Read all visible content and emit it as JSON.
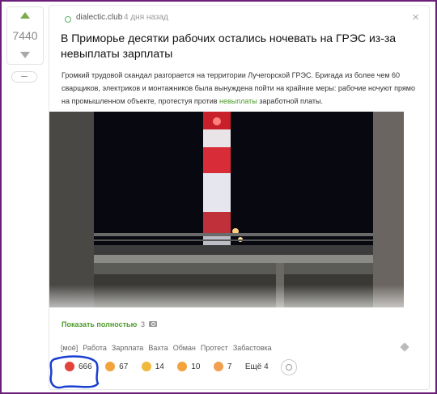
{
  "vote": {
    "count": "7440"
  },
  "post": {
    "source": "dialectic.club",
    "time": "4 дня назад",
    "close": "×",
    "title": "В Приморье десятки рабочих остались ночевать на ГРЭС из-за невыплаты зарплаты",
    "text_before": "Громкий трудовой скандал разгорается на территории Лучегорской ГРЭС. Бригада из более чем 60 сварщиков, электриков и монтажников была вынуждена пойти на крайние меры: рабочие ночуют прямо на промышленном объекте, протестуя против ",
    "text_link": "невыплаты",
    "text_after": " заработной платы.",
    "show_more": "Показать полностью",
    "photo_count": "3"
  },
  "tags": [
    "[моё]",
    "Работа",
    "Зарплата",
    "Вахта",
    "Обман",
    "Протест",
    "Забастовка"
  ],
  "reactions": [
    {
      "icon": "angry-face-icon",
      "count": "666",
      "color": "#e2433a"
    },
    {
      "icon": "crying-face-icon",
      "count": "67",
      "color": "#f1a33c"
    },
    {
      "icon": "laughing-face-icon",
      "count": "14",
      "color": "#f1b93c"
    },
    {
      "icon": "grinning-face-icon",
      "count": "10",
      "color": "#f1a33c"
    },
    {
      "icon": "clapping-hands-icon",
      "count": "7",
      "color": "#f0a050"
    }
  ],
  "more_reactions": "Ещё 4",
  "colors": {
    "accent_green": "#4d9a2a",
    "frame": "#6b1f7a",
    "annotation": "#1a3fd1"
  }
}
